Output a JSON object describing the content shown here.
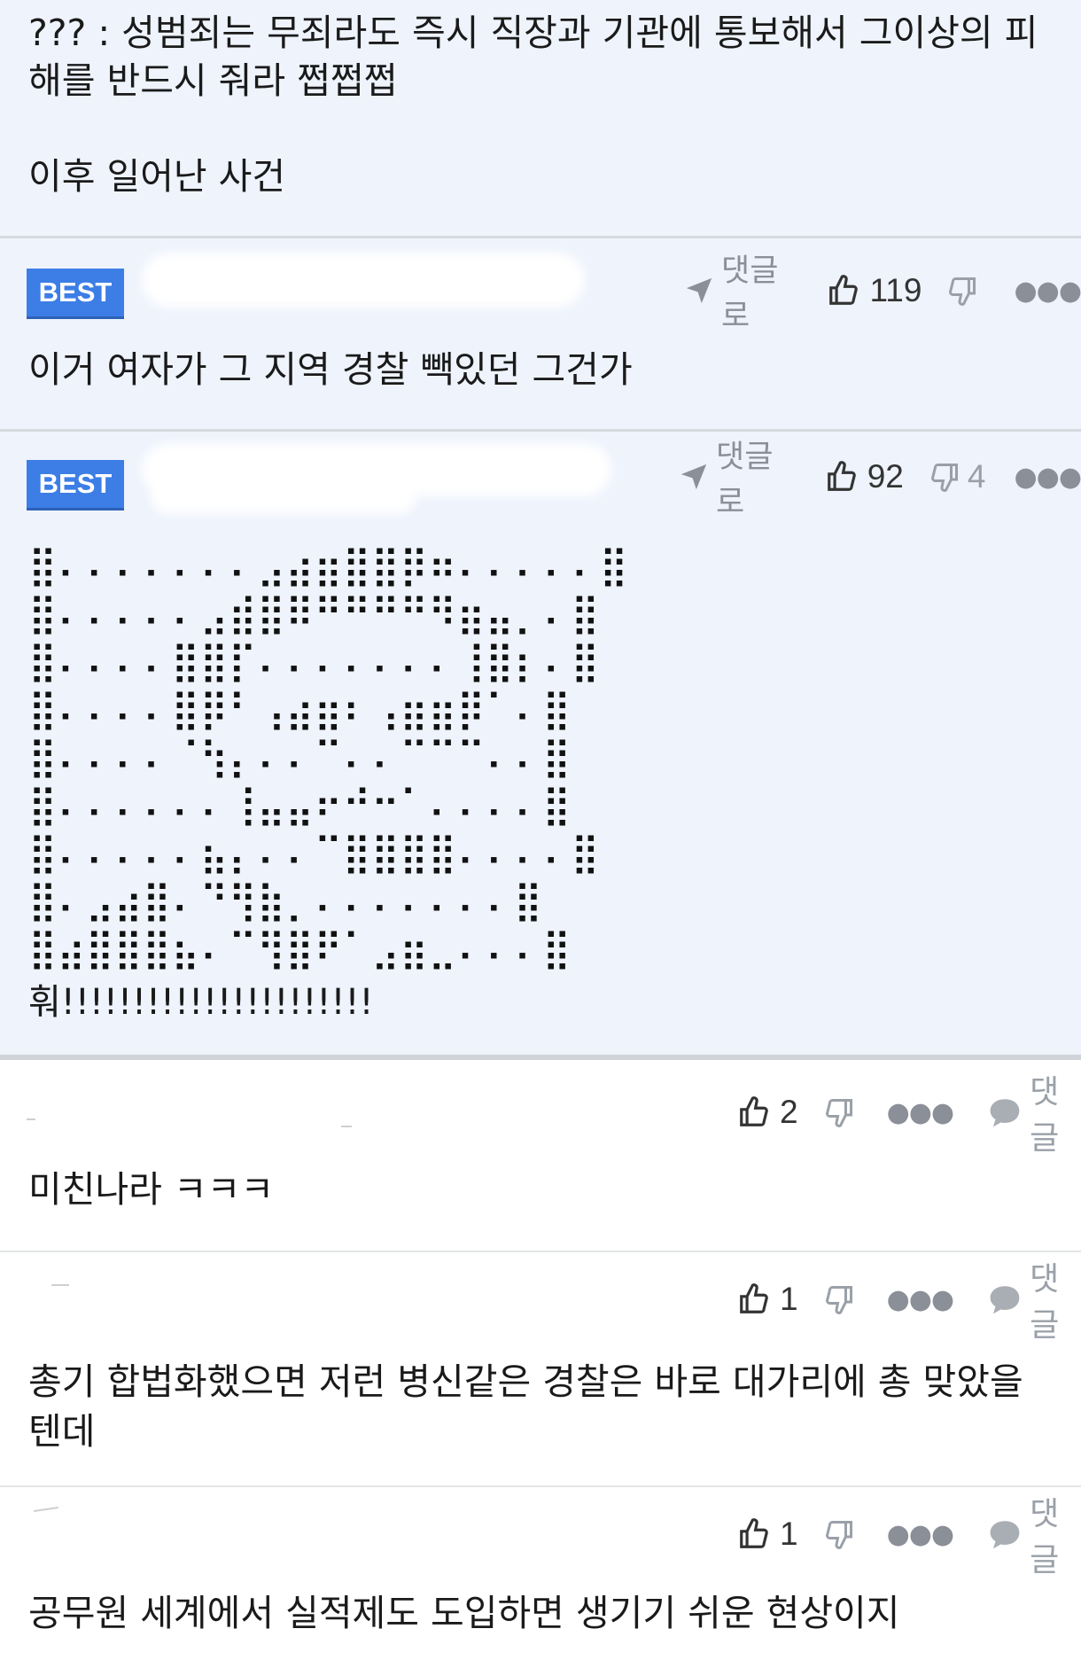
{
  "post": {
    "text": "??? : 성범죄는 무죄라도 즉시 직장과 기관에 통보해서 그이상의 피해를 반드시 줘라 쩝쩝쩝\n\n이후 일어난 사건"
  },
  "best_comments": [
    {
      "badge": "BEST",
      "reply_label": "댓글로",
      "likes": "119",
      "dislikes": "",
      "text": "이거 여자가 그 지역 경찰 빽있던 그건가"
    },
    {
      "badge": "BEST",
      "reply_label": "댓글로",
      "likes": "92",
      "dislikes": "4",
      "braille_art": "⣿⠄⠄⠄⠄⠄⠄⠄⣠⣴⣶⣿⣿⡿⠶⠄⠄⠄⠄⠄⣿\n⣿⠄⠄⠄⠄⠄⣠⣾⣿⠿⠛⠛⠛⠛⠻⣶⣤⡀⠄⣿\n⣿⠄⠄⠄⠄⣿⣿⡏⠄⠄⠄⠄⠄⠄⠄⢸⣿⡆⠄⣿\n⣿⠄⠄⠄⠄⣿⡿⠃⢠⣴⣶⠆⢠⣶⣶⡿⠁⠄⣿\n⣿⠄⠄⠄⠄⠈⢳⡄⠄⠄⠉⠄⠄⠉⠉⠉⠄⠄⣿\n⣿⠄⠄⠄⠄⠄⠄⢸⣤⣤⠖⠚⠒⠁⠄⠄⠄⠄⣿\n⣿⠄⠄⠄⠄⠄⣦⡄⠄⠄⠉⣿⣿⣿⣿⠄⠄⠄⠄⣿\n⣿⠄⣠⣴⣿⠄⠙⢻⣷⡀⠄⠄⠄⠄⠄⠄⠄⣿\n⣿⣴⣿⣿⣿⣦⠄⠉⢻⣿⠟⠁⣠⣶⣀⠄⠄⠄⣿",
      "text": "훠!!!!!!!!!!!!!!!!!!!!!!"
    }
  ],
  "comments": [
    {
      "likes": "2",
      "reply_label": "댓글",
      "text": "미친나라 ㅋㅋㅋ"
    },
    {
      "likes": "1",
      "reply_label": "댓글",
      "text": "총기 합법화했으면 저런 병신같은 경찰은 바로 대가리에 총 맞았을 텐데"
    },
    {
      "likes": "1",
      "reply_label": "댓글",
      "text": "공무원 세계에서 실적제도 도입하면 생기기 쉬운 현상이지"
    }
  ],
  "colors": {
    "best_bg": "#eef3fc",
    "best_badge": "#3c7ee6",
    "meta_grey": "#8a8f98"
  },
  "icons": [
    "send-arrow-icon",
    "thumbs-up-icon",
    "thumbs-down-icon",
    "more-dots-icon",
    "speech-bubble-icon"
  ]
}
